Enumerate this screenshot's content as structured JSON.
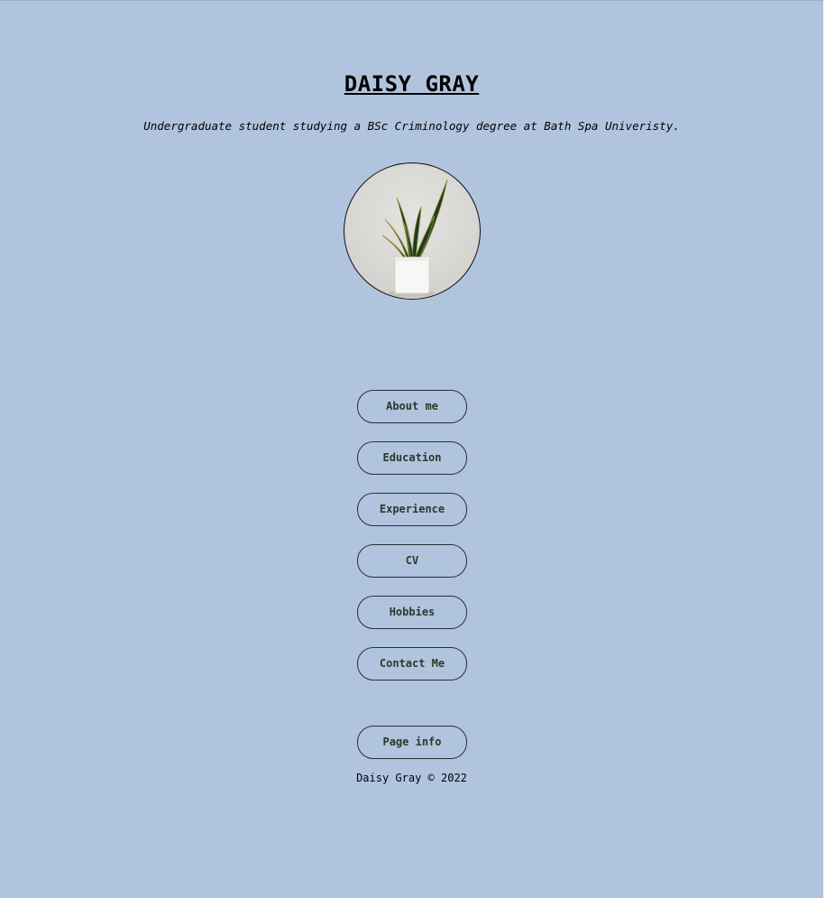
{
  "header": {
    "title": "DAISY GRAY",
    "tagline": "Undergraduate student studying a BSc Criminology degree at Bath Spa Univeristy."
  },
  "profile": {
    "image_description_icon": "potted-snake-plant-photo"
  },
  "nav": {
    "about": "About me",
    "education": "Education",
    "experience": "Experience",
    "cv": "CV",
    "hobbies": "Hobbies",
    "contact": "Contact Me",
    "page_info": "Page info"
  },
  "footer": {
    "copyright": "Daisy Gray © 2022"
  },
  "colors": {
    "background": "#b0c4de",
    "button_border": "#2b2f33",
    "button_text": "#2a3a2a"
  }
}
